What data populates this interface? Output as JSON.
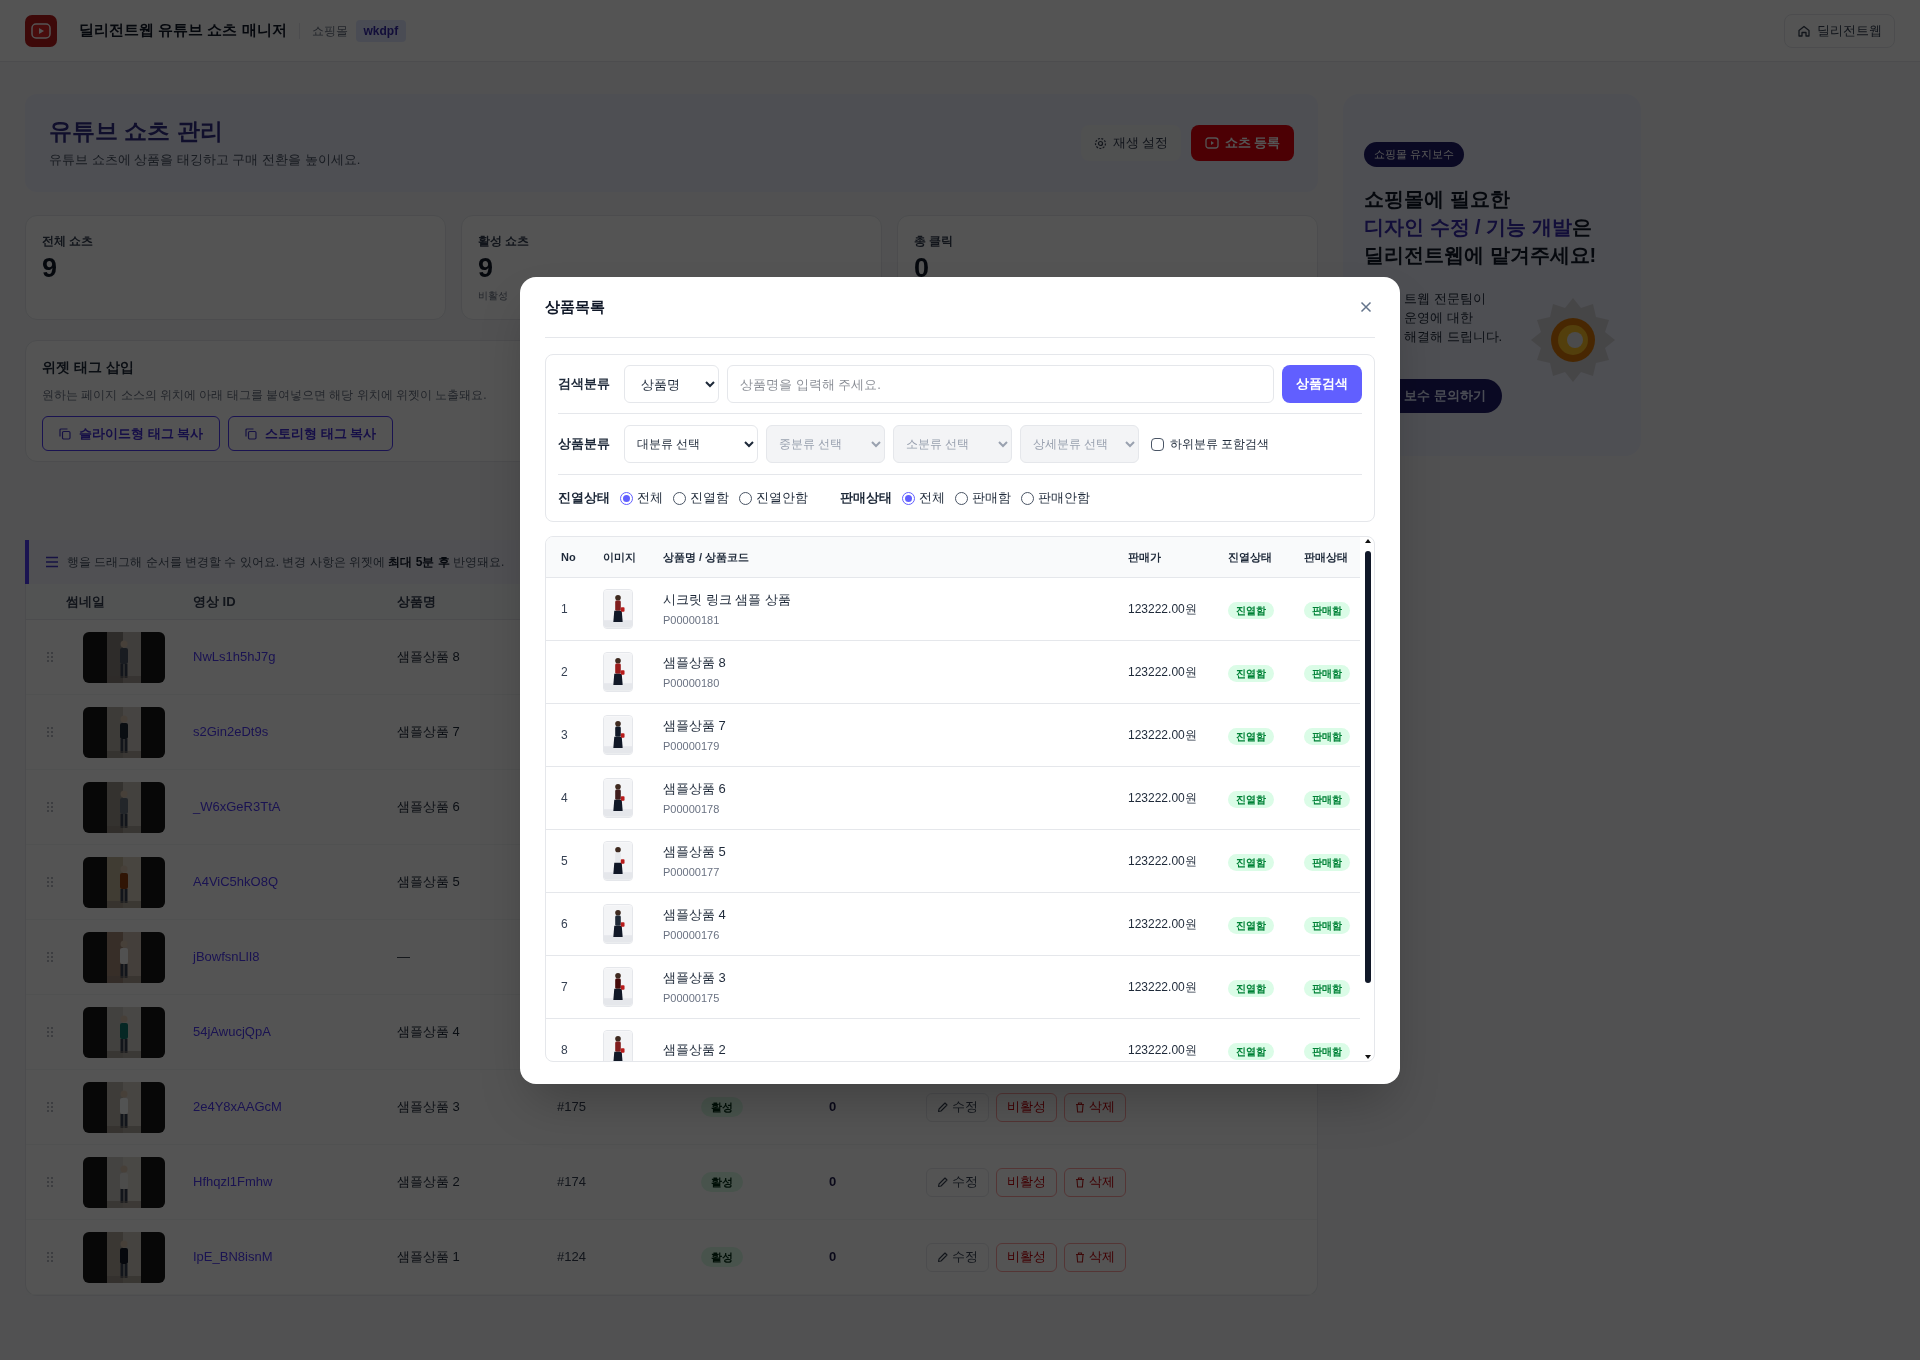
{
  "header": {
    "title": "딜리전트웹 유튜브 쇼츠 매니저",
    "shop_label": "쇼핑몰",
    "shop_id": "wkdpf",
    "home_button": "딜리전트웹"
  },
  "hero": {
    "title": "유튜브 쇼츠 관리",
    "subtitle": "유튜브 쇼츠에 상품을 태깅하고 구매 전환을 높이세요.",
    "buttons": [
      {
        "label": "재생 설정",
        "kind": "settings"
      },
      {
        "label": "쇼츠 등록",
        "kind": "primary"
      }
    ]
  },
  "stats": [
    {
      "label": "전체 쇼츠",
      "value": "9"
    },
    {
      "label": "활성 쇼츠",
      "value": "9",
      "sub": "비활성"
    },
    {
      "label": "총 클릭",
      "value": "0"
    }
  ],
  "widget": {
    "title": "위젯 태그 삽입",
    "description": "원하는 페이지 소스의 위치에 아래 태그를 붙여넣으면 해당 위치에 위젯이 노출돼요.",
    "buttons": [
      "슬라이드형 태그 복사",
      "스토리형 태그 복사"
    ]
  },
  "notice": "행을 드래그해 순서를 변경할 수 있어요. 변경 사항은 위젯에 **최대 5분 후** 반영돼요.",
  "shorts_table": {
    "columns": [
      "썸네일",
      "영상 ID",
      "상품명"
    ],
    "rows": [
      {
        "video_id": "NwLs1h5hJ7g",
        "product": "샘플상품 8"
      },
      {
        "video_id": "s2Gin2eDt9s",
        "product": "샘플상품 7"
      },
      {
        "video_id": "_W6xGeR3TtA",
        "product": "샘플상품 6"
      },
      {
        "video_id": "A4ViC5hkO8Q",
        "product": "샘플상품 5"
      },
      {
        "video_id": "jBowfsnLlI8",
        "product": "—"
      },
      {
        "video_id": "54jAwucjQpA",
        "product": "샘플상품 4"
      },
      {
        "video_id": "2e4Y8xAAGcM",
        "product": "샘플상품 3",
        "product_no": "#175",
        "status": "활성",
        "clicks": "0",
        "actions": [
          {
            "label": "수정",
            "kind": "edit"
          },
          {
            "label": "비활성",
            "kind": "toggle"
          },
          {
            "label": "삭제",
            "kind": "delete"
          }
        ]
      },
      {
        "video_id": "Hfhqzl1Fmhw",
        "product": "샘플상품 2",
        "product_no": "#174",
        "status": "활성",
        "clicks": "0",
        "actions": [
          {
            "label": "수정",
            "kind": "edit"
          },
          {
            "label": "비활성",
            "kind": "toggle"
          },
          {
            "label": "삭제",
            "kind": "delete"
          }
        ]
      },
      {
        "video_id": "IpE_BN8isnM",
        "product": "샘플상품 1",
        "product_no": "#124",
        "status": "활성",
        "clicks": "0",
        "actions": [
          {
            "label": "수정",
            "kind": "edit"
          },
          {
            "label": "비활성",
            "kind": "toggle"
          },
          {
            "label": "삭제",
            "kind": "delete"
          }
        ]
      }
    ]
  },
  "ad": {
    "badge": "쇼핑몰 유지보수",
    "heading": {
      "line1": "쇼핑몰에 필요한",
      "highlight": "디자인 수정 / 기능 개발",
      "after_highlight": "은",
      "line3": "딜리전트웹에 맡겨주세요!"
    },
    "body_lines": [
      "트웹 전문팀이",
      "운영에 대한",
      "해결해 드립니다."
    ],
    "button": "보수 문의하기"
  },
  "modal": {
    "title": "상품목록",
    "search": {
      "label": "검색분류",
      "select": "상품명",
      "placeholder": "상품명을 입력해 주세요.",
      "button": "상품검색"
    },
    "category": {
      "label": "상품분류",
      "selects": [
        {
          "value": "대분류 선택",
          "disabled": false
        },
        {
          "value": "중분류 선택",
          "disabled": true
        },
        {
          "value": "소분류 선택",
          "disabled": true
        },
        {
          "value": "상세분류 선택",
          "disabled": true
        }
      ],
      "checkbox": {
        "label": "하위분류 포함검색",
        "checked": false
      }
    },
    "filters": [
      {
        "label": "진열상태",
        "options": [
          {
            "label": "전체",
            "selected": true
          },
          {
            "label": "진열함",
            "selected": false
          },
          {
            "label": "진열안함",
            "selected": false
          }
        ]
      },
      {
        "label": "판매상태",
        "options": [
          {
            "label": "전체",
            "selected": true
          },
          {
            "label": "판매함",
            "selected": false
          },
          {
            "label": "판매안함",
            "selected": false
          }
        ]
      }
    ],
    "table": {
      "columns": [
        "No",
        "이미지",
        "상품명 / 상품코드",
        "판매가",
        "진열상태",
        "판매상태"
      ],
      "rows": [
        {
          "no": "1",
          "name": "시크릿 링크 샘플 상품",
          "code": "P00000181",
          "price": "123222.00원",
          "display": "진열함",
          "sale": "판매함"
        },
        {
          "no": "2",
          "name": "샘플상품 8",
          "code": "P00000180",
          "price": "123222.00원",
          "display": "진열함",
          "sale": "판매함"
        },
        {
          "no": "3",
          "name": "샘플상품 7",
          "code": "P00000179",
          "price": "123222.00원",
          "display": "진열함",
          "sale": "판매함"
        },
        {
          "no": "4",
          "name": "샘플상품 6",
          "code": "P00000178",
          "price": "123222.00원",
          "display": "진열함",
          "sale": "판매함"
        },
        {
          "no": "5",
          "name": "샘플상품 5",
          "code": "P00000177",
          "price": "123222.00원",
          "display": "진열함",
          "sale": "판매함"
        },
        {
          "no": "6",
          "name": "샘플상품 4",
          "code": "P00000176",
          "price": "123222.00원",
          "display": "진열함",
          "sale": "판매함"
        },
        {
          "no": "7",
          "name": "샘플상품 3",
          "code": "P00000175",
          "price": "123222.00원",
          "display": "진열함",
          "sale": "판매함"
        },
        {
          "no": "8",
          "name": "샘플상품 2",
          "price": "123222.00원",
          "display": "진열함",
          "sale": "판매함"
        }
      ]
    }
  }
}
